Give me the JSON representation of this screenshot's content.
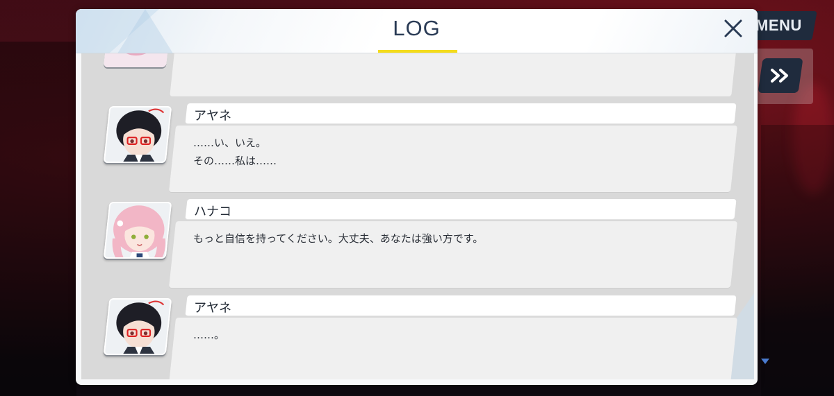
{
  "hud": {
    "menu_label": "MENU",
    "skip_icon": "fast-forward-icon"
  },
  "log_panel": {
    "title": "LOG",
    "close_icon": "close-icon",
    "accent_color": "#f4dc1c",
    "title_color": "#2a3b55"
  },
  "entries": [
    {
      "speaker": "アヤネ",
      "lines": [
        "……い、いえ。",
        "その……私は……"
      ],
      "avatar_icon": "ayane-portrait"
    },
    {
      "speaker": "ハナコ",
      "lines": [
        "もっと自信を持ってください。大丈夫、あなたは強い方です。"
      ],
      "avatar_icon": "hanako-portrait"
    },
    {
      "speaker": "アヤネ",
      "lines": [
        "……。"
      ],
      "avatar_icon": "ayane-portrait"
    }
  ]
}
